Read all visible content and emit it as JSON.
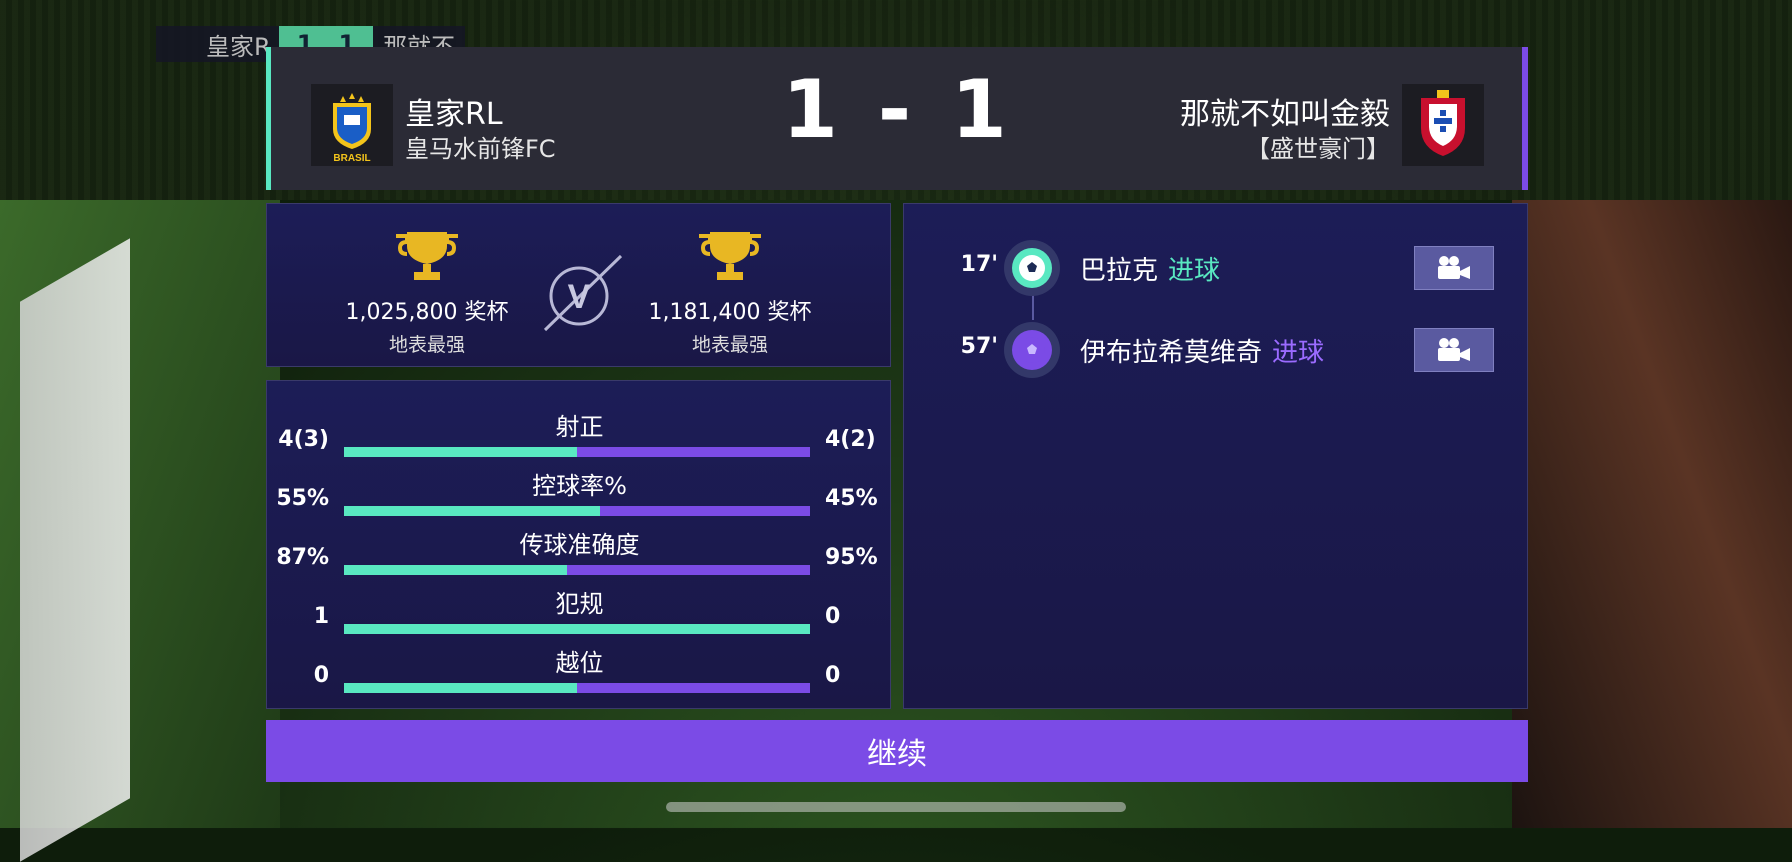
{
  "mini_score": {
    "home": "皇家R",
    "score_home": "1",
    "score_away": "1",
    "away": "那就不"
  },
  "header": {
    "home_name": "皇家RL",
    "home_sub": "皇马水前锋FC",
    "home_badge_text": "BRASIL",
    "score_home": "1",
    "score_sep": "-",
    "score_away": "1",
    "away_name": "那就不如叫金毅",
    "away_sub": "【盛世豪门】"
  },
  "trophies": {
    "home": {
      "count": "1,025,800 奖杯",
      "rank": "地表最强"
    },
    "vs": "V",
    "away": {
      "count": "1,181,400 奖杯",
      "rank": "地表最强"
    }
  },
  "stats": [
    {
      "label": "射正",
      "home": "4(3)",
      "away": "4(2)",
      "home_share": 0.5
    },
    {
      "label": "控球率%",
      "home": "55%",
      "away": "45%",
      "home_share": 0.55
    },
    {
      "label": "传球准确度",
      "home": "87%",
      "away": "95%",
      "home_share": 0.478
    },
    {
      "label": "犯规",
      "home": "1",
      "away": "0",
      "home_share": 1.0
    },
    {
      "label": "越位",
      "home": "0",
      "away": "0",
      "home_share": 0.5
    }
  ],
  "events": [
    {
      "minute": "17'",
      "player": "巴拉克",
      "type": "进球",
      "team": "home",
      "color": "#59e8c1"
    },
    {
      "minute": "57'",
      "player": "伊布拉希莫维奇",
      "type": "进球",
      "team": "away",
      "color": "#7b4be6"
    }
  ],
  "continue_label": "继续",
  "colors": {
    "home": "#59e8c1",
    "away": "#7b4be6"
  }
}
